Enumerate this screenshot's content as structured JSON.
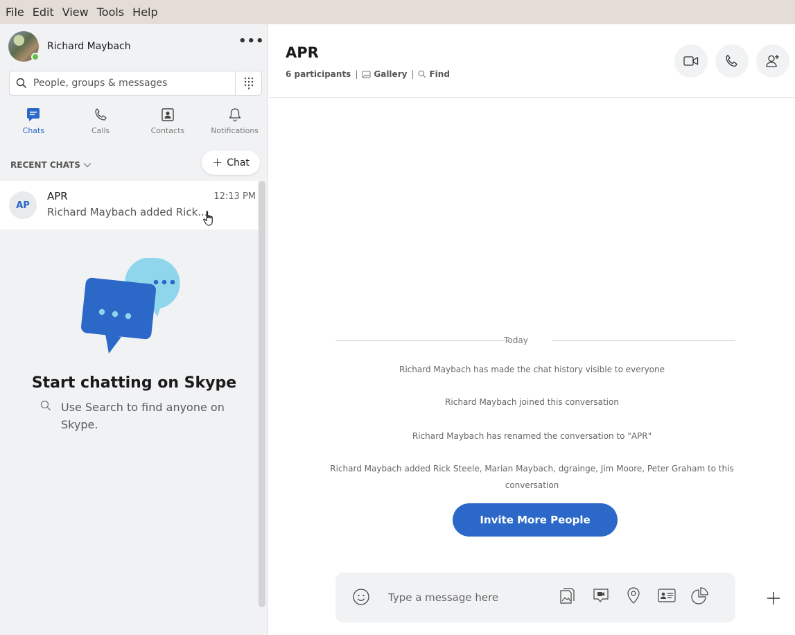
{
  "menu": {
    "items": [
      "File",
      "Edit",
      "View",
      "Tools",
      "Help"
    ]
  },
  "profile": {
    "name": "Richard Maybach",
    "status": "online",
    "more": "•••"
  },
  "search": {
    "placeholder": "People, groups & messages"
  },
  "nav": {
    "tabs": [
      {
        "label": "Chats",
        "icon": "chat-icon",
        "active": true
      },
      {
        "label": "Calls",
        "icon": "phone-icon",
        "active": false
      },
      {
        "label": "Contacts",
        "icon": "contacts-icon",
        "active": false
      },
      {
        "label": "Notifications",
        "icon": "bell-icon",
        "active": false
      }
    ]
  },
  "recent": {
    "header": "RECENT CHATS",
    "new_chat_label": "Chat"
  },
  "chats": [
    {
      "initials": "AP",
      "name": "APR",
      "time": "12:13 PM",
      "preview": "Richard Maybach added Rick..."
    }
  ],
  "empty_state": {
    "title": "Start chatting on Skype",
    "subtitle": "Use Search to find anyone on Skype."
  },
  "conversation": {
    "title": "APR",
    "participants": "6 participants",
    "gallery": "Gallery",
    "find": "Find",
    "day_label": "Today",
    "events": [
      "Richard Maybach has made the chat history visible to everyone",
      "Richard Maybach joined this conversation",
      "Richard Maybach has renamed the conversation to \"APR\"",
      "Richard Maybach added Rick Steele, Marian Maybach, dgrainge, Jim Moore, Peter Graham to this conversation"
    ],
    "invite_label": "Invite More People"
  },
  "composer": {
    "placeholder": "Type a message here"
  },
  "colors": {
    "accent": "#2c68c8",
    "menubar": "#e3ddd6",
    "sidebar": "#f1f2f4",
    "presence": "#5fc249"
  }
}
